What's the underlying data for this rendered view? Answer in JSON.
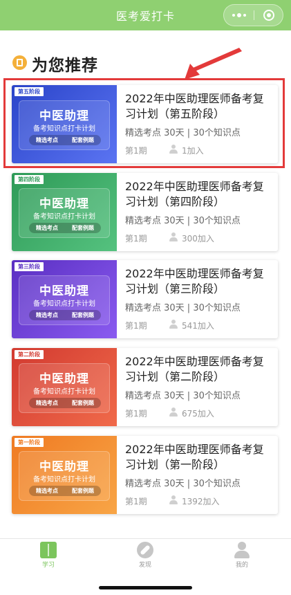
{
  "header": {
    "title": "医考爱打卡"
  },
  "section": {
    "title": "为您推荐"
  },
  "cards": [
    {
      "tag": "第五阶段",
      "thumb_title": "中医助理",
      "thumb_subtitle": "备考知识点打卡计划",
      "thumb_btn1": "精选考点",
      "thumb_btn2": "配套例题",
      "title": "2022年中医助理医师备考复习计划（第五阶段）",
      "meta": "精选考点  30天 | 30个知识点",
      "issue": "第1期",
      "joined": "1加入"
    },
    {
      "tag": "第四阶段",
      "thumb_title": "中医助理",
      "thumb_subtitle": "备考知识点打卡计划",
      "thumb_btn1": "精选考点",
      "thumb_btn2": "配套例题",
      "title": "2022年中医助理医师备考复习计划（第四阶段）",
      "meta": "精选考点  30天 | 30个知识点",
      "issue": "第1期",
      "joined": "300加入"
    },
    {
      "tag": "第三阶段",
      "thumb_title": "中医助理",
      "thumb_subtitle": "备考知识点打卡计划",
      "thumb_btn1": "精选考点",
      "thumb_btn2": "配套例题",
      "title": "2022年中医助理医师备考复习计划（第三阶段）",
      "meta": "精选考点  30天 | 30个知识点",
      "issue": "第1期",
      "joined": "541加入"
    },
    {
      "tag": "第二阶段",
      "thumb_title": "中医助理",
      "thumb_subtitle": "备考知识点打卡计划",
      "thumb_btn1": "精选考点",
      "thumb_btn2": "配套例题",
      "title": "2022年中医助理医师备考复习计划（第二阶段）",
      "meta": "精选考点  30天 | 30个知识点",
      "issue": "第1期",
      "joined": "675加入"
    },
    {
      "tag": "第一阶段",
      "thumb_title": "中医助理",
      "thumb_subtitle": "备考知识点打卡计划",
      "thumb_btn1": "精选考点",
      "thumb_btn2": "配套例题",
      "title": "2022年中医助理医师备考复习计划（第一阶段）",
      "meta": "精选考点  30天 | 30个知识点",
      "issue": "第1期",
      "joined": "1392加入"
    }
  ],
  "tabbar": {
    "study": "学习",
    "discover": "发现",
    "mine": "我的"
  },
  "colors": {
    "brand_green": "#8fd071",
    "annotation_red": "#e33a3a"
  }
}
